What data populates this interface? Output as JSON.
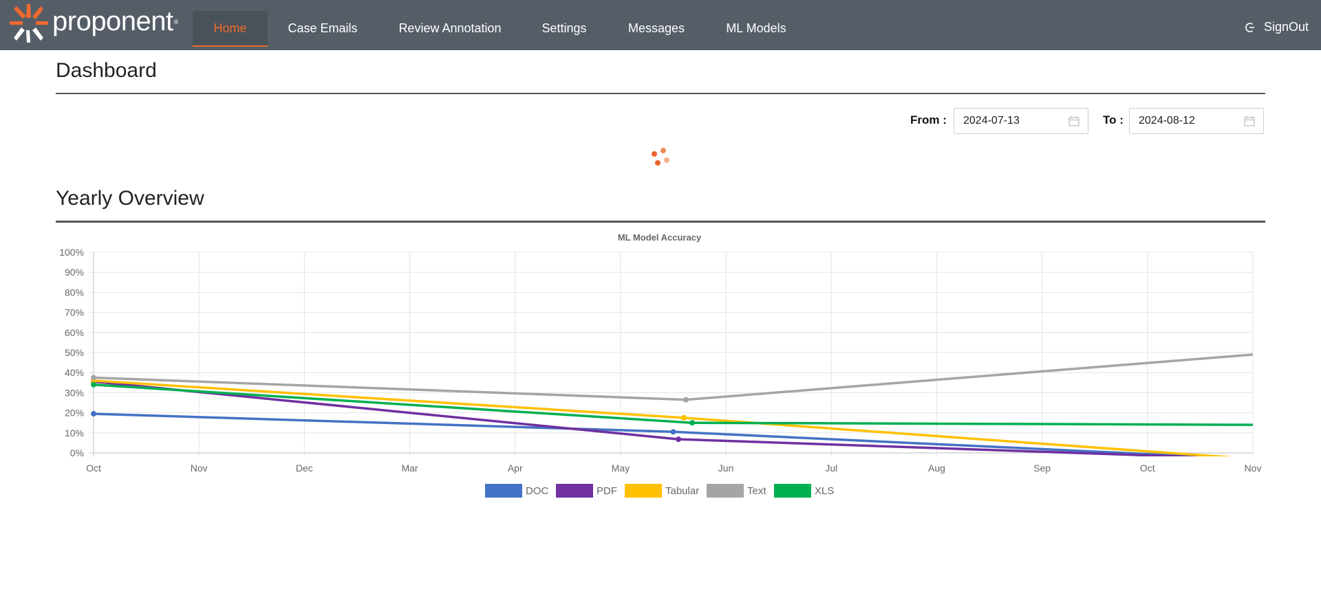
{
  "nav": {
    "logo_text": "proponent",
    "items": [
      {
        "label": "Home",
        "active": true
      },
      {
        "label": "Case Emails"
      },
      {
        "label": "Review Annotation"
      },
      {
        "label": "Settings"
      },
      {
        "label": "Messages"
      },
      {
        "label": "ML Models"
      }
    ],
    "signout_label": "SignOut"
  },
  "dashboard": {
    "title": "Dashboard",
    "from_label": "From :",
    "from_value": "2024-07-13",
    "to_label": "To :",
    "to_value": "2024-08-12"
  },
  "overview": {
    "title": "Yearly Overview"
  },
  "colors": {
    "nav_bg": "#555e67",
    "accent": "#ef6a2e"
  },
  "chart_data": {
    "type": "line",
    "title": "ML Model Accuracy",
    "x": [
      "Oct",
      "Nov",
      "Dec",
      "Mar",
      "Apr",
      "May",
      "Jun",
      "Jul",
      "Aug",
      "Sep",
      "Oct",
      "Nov"
    ],
    "ylim": [
      0,
      100
    ],
    "y_ticks": [
      "0%",
      "10%",
      "20%",
      "30%",
      "40%",
      "50%",
      "60%",
      "70%",
      "80%",
      "90%",
      "100%"
    ],
    "grid": true,
    "legend": "bottom",
    "series": [
      {
        "name": "DOC",
        "color": "#4472c4",
        "points": [
          [
            0,
            19.5
          ],
          [
            5.5,
            10.5
          ],
          [
            11,
            -3
          ]
        ]
      },
      {
        "name": "PDF",
        "color": "#7030a0",
        "points": [
          [
            0,
            35.5
          ],
          [
            5.55,
            6.8
          ],
          [
            11,
            -3
          ]
        ]
      },
      {
        "name": "Tabular",
        "color": "#ffc000",
        "points": [
          [
            0,
            36
          ],
          [
            5.6,
            17.5
          ],
          [
            11,
            -3
          ]
        ]
      },
      {
        "name": "Text",
        "color": "#a5a5a5",
        "points": [
          [
            0,
            37.5
          ],
          [
            5.62,
            26.5
          ],
          [
            11,
            49
          ]
        ]
      },
      {
        "name": "XLS",
        "color": "#00b050",
        "points": [
          [
            0,
            34
          ],
          [
            5.68,
            15
          ],
          [
            11,
            14
          ]
        ]
      }
    ]
  }
}
